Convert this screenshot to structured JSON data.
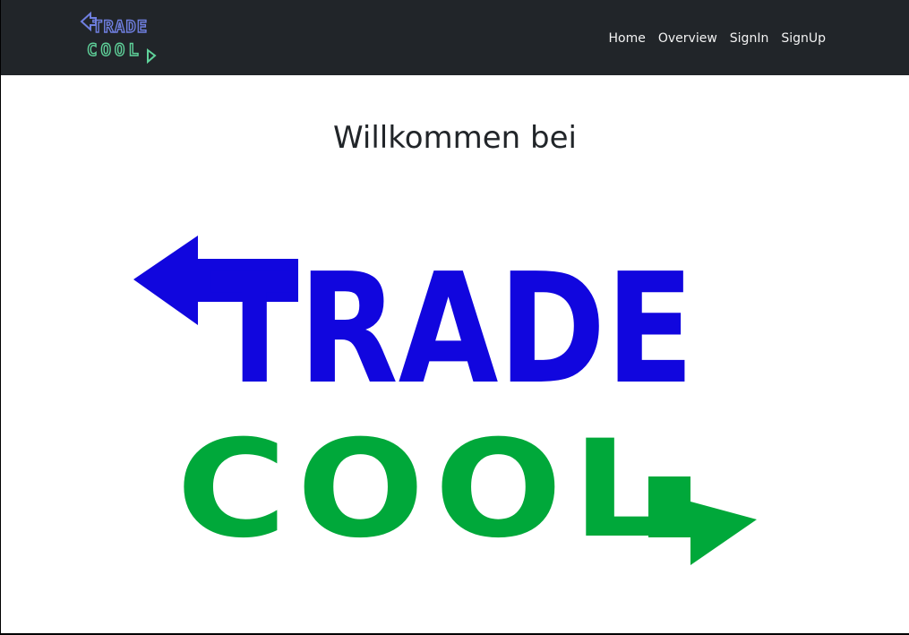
{
  "brand": {
    "name": "Trade Cool",
    "logo_word_top": "TRADE",
    "logo_word_bottom": "COOL"
  },
  "nav": {
    "links": [
      {
        "label": "Home"
      },
      {
        "label": "Overview"
      },
      {
        "label": "SignIn"
      },
      {
        "label": "SignUp"
      }
    ]
  },
  "main": {
    "heading": "Willkommen bei"
  },
  "colors": {
    "navbar_bg": "#212529",
    "trade_blue": "#1106de",
    "cool_green": "#00a83a",
    "nav_logo_blue": "#6f7fe0",
    "nav_logo_green": "#5fd29a"
  }
}
